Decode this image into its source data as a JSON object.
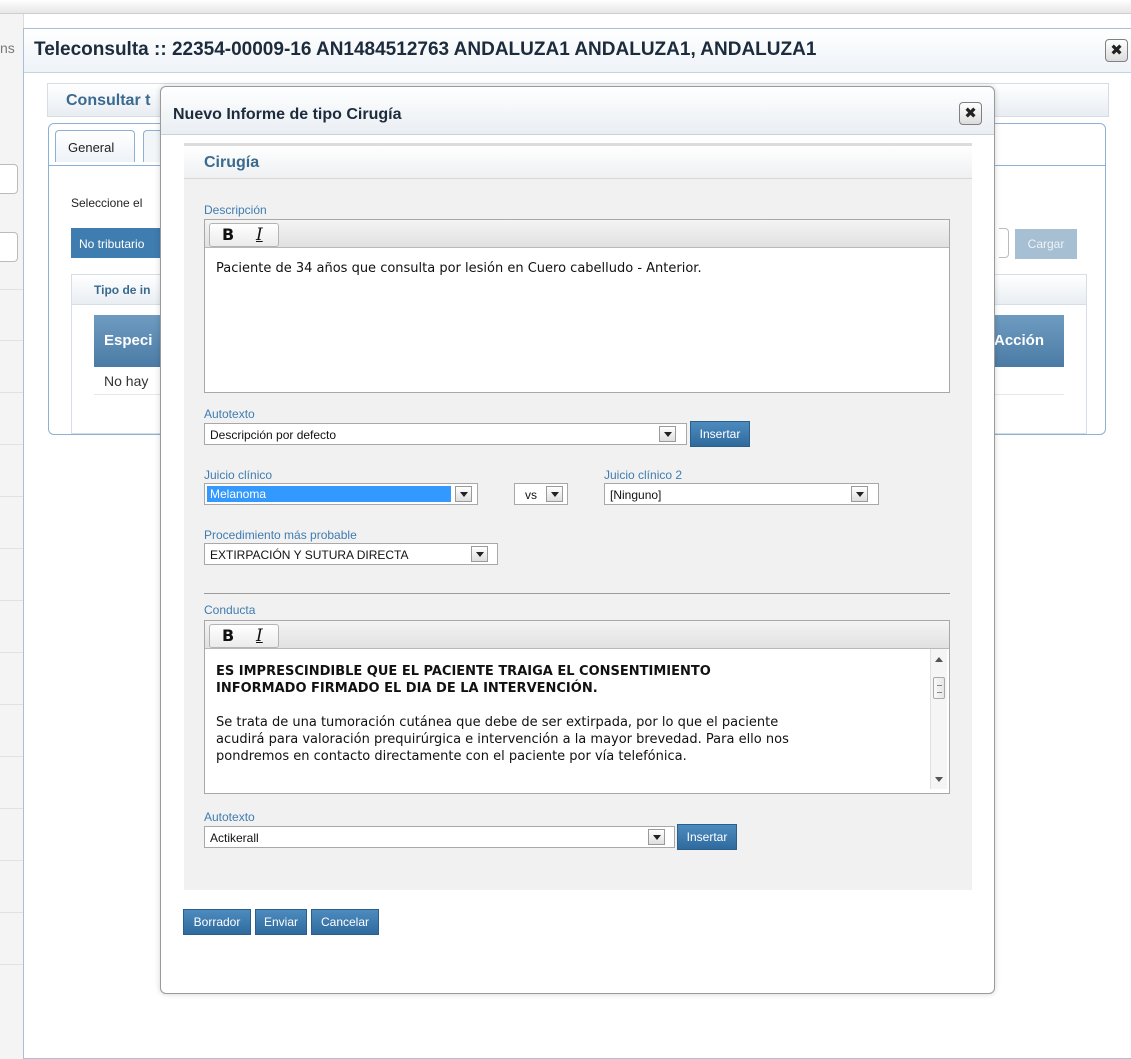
{
  "background": {
    "left_fragment": "ns"
  },
  "window": {
    "title": "Teleconsulta :: 22354-00009-16 AN1484512763 ANDALUZA1 ANDALUZA1, ANDALUZA1",
    "close_icon": "close-icon"
  },
  "behind": {
    "consult_title": "Consultar t",
    "tab_general": "General",
    "select_text": "Seleccione el",
    "blue_select": "No tributario",
    "cargar": "Cargar",
    "tipo_label": "Tipo de in",
    "col_especialidad": "Especi",
    "col_accion": "Acción",
    "no_hay": "No hay"
  },
  "dialog": {
    "title": "Nuevo Informe de tipo Cirugía",
    "section_title": "Cirugía",
    "descripcion": {
      "label": "Descripción",
      "bold": "B",
      "italic": "I",
      "text": "Paciente de 34 años que consulta por lesión en Cuero cabelludo - Anterior."
    },
    "autotexto1": {
      "label": "Autotexto",
      "value": "Descripción por defecto",
      "button": "Insertar"
    },
    "juicio1": {
      "label": "Juicio clínico",
      "value": "Melanoma"
    },
    "vs": {
      "value": "vs"
    },
    "juicio2": {
      "label": "Juicio clínico 2",
      "value": "[Ninguno]"
    },
    "procedimiento": {
      "label": "Procedimiento más probable",
      "value": "EXTIRPACIÓN Y SUTURA DIRECTA"
    },
    "conducta": {
      "label": "Conducta",
      "bold": "B",
      "italic": "I",
      "bold_line1": "ES IMPRESCINDIBLE QUE EL PACIENTE TRAIGA EL CONSENTIMIENTO",
      "bold_line2": "INFORMADO FIRMADO EL DIA DE LA INTERVENCIÓN.",
      "line1": "Se trata de una tumoración cutánea que debe de ser extirpada, por lo que el paciente",
      "line2": "acudirá para valoración prequirúrgica e intervención a la mayor brevedad. Para ello nos",
      "line3": "pondremos en contacto directamente con el paciente por vía telefónica."
    },
    "autotexto2": {
      "label": "Autotexto",
      "value": "Actikerall",
      "button": "Insertar"
    },
    "buttons": {
      "borrador": "Borrador",
      "enviar": "Enviar",
      "cancelar": "Cancelar"
    }
  },
  "colors": {
    "accent_blue": "#3f7cb0",
    "selection_blue": "#3399ff",
    "header_blue": "#4b7ba5"
  }
}
